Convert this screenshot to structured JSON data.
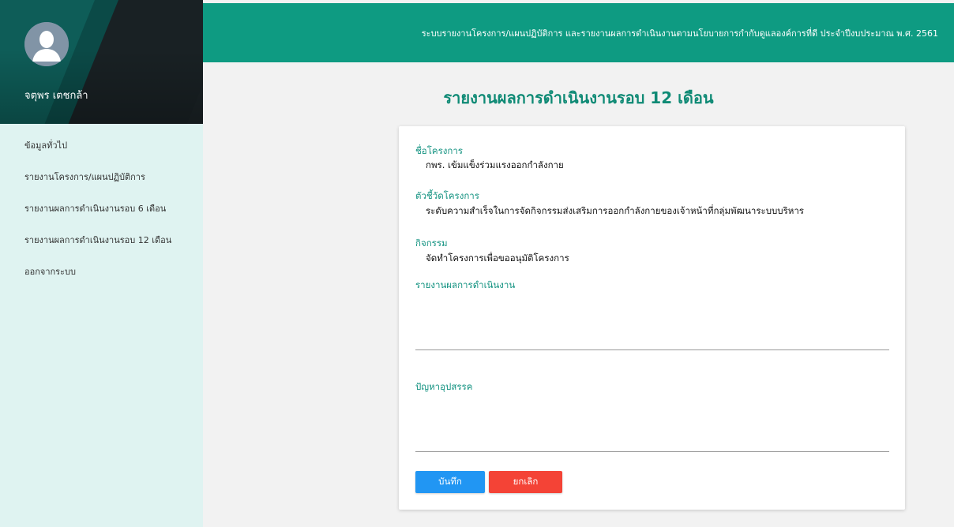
{
  "header": {
    "title": "ระบบรายงานโครงการ/แผนปฏิบัติการ และรายงานผลการดำเนินงานตามนโยบายการกำกับดูแลองค์การที่ดี ประจำปีงบประมาณ พ.ศ. 2561"
  },
  "sidebar": {
    "user_name": "จตุพร เตชกล้า",
    "items": [
      {
        "label": "ข้อมูลทั่วไป"
      },
      {
        "label": "รายงานโครงการ/แผนปฏิบัติการ"
      },
      {
        "label": "รายงานผลการดำเนินงานรอบ 6 เดือน"
      },
      {
        "label": "รายงานผลการดำเนินงานรอบ 12 เดือน"
      },
      {
        "label": "ออกจากระบบ"
      }
    ]
  },
  "main": {
    "page_title": "รายงานผลการดำเนินงานรอบ 12 เดือน",
    "project_name_label": "ชื่อโครงการ",
    "project_name_value": "กพร. เข้มแข็งร่วมแรงออกกำลังกาย",
    "indicator_label": "ตัวชี้วัดโครงการ",
    "indicator_value": "ระดับความสำเร็จในการจัดกิจกรรมส่งเสริมการออกกำลังกายของเจ้าหน้าที่กลุ่มพัฒนาระบบบริหาร",
    "activity_label": "กิจกรรม",
    "activity_value": "จัดทำโครงการเพื่อขออนุมัติโครงการ",
    "result_label": "รายงานผลการดำเนินงาน",
    "result_value": "",
    "problem_label": "ปัญหาอุปสรรค",
    "problem_value": "",
    "save_label": "บันทึก",
    "cancel_label": "ยกเลิก"
  },
  "colors": {
    "header_bg": "#0e9b82",
    "title_text": "#0f8a75",
    "label_text": "#129280",
    "sidebar_bg": "#dff3f1",
    "save_button": "#2196f3",
    "cancel_button": "#f44336"
  },
  "icons": {
    "avatar": "user-silhouette-icon"
  }
}
